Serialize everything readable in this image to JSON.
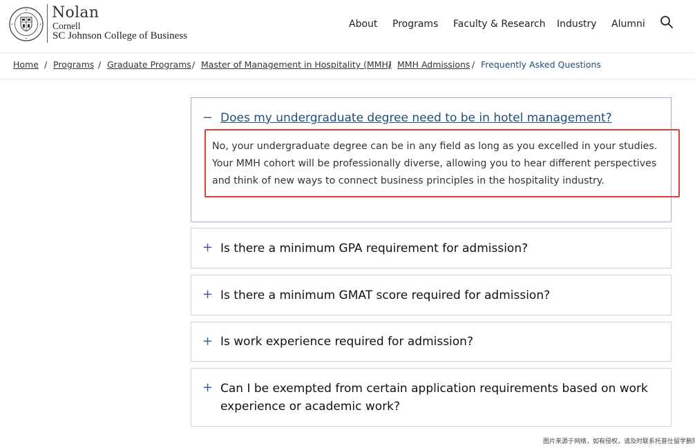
{
  "header": {
    "logo": {
      "seal_text": "CORNELL UNIVERSITY · FOUNDED A.D. 1865",
      "nolan": "Nolan",
      "cornell": "Cornell",
      "school": "SC Johnson College of Business"
    },
    "nav": [
      {
        "label": "About"
      },
      {
        "label": "Programs"
      },
      {
        "label": "Faculty & Research"
      },
      {
        "label": "Industry"
      },
      {
        "label": "Alumni"
      }
    ],
    "search_icon": "search-icon"
  },
  "breadcrumb": {
    "items": [
      "Home",
      "Programs",
      "Graduate Programs",
      "Master of Management in Hospitality (MMH)",
      "MMH Admissions"
    ],
    "separator": "/",
    "current": "Frequently Asked Questions"
  },
  "faq": {
    "items": [
      {
        "toggle": "−",
        "question": "Does my undergraduate degree need to be in hotel management?",
        "answer_lines": [
          "No, your undergraduate degree can be in any field as long as you excelled in your studies.",
          "Your MMH cohort will be professionally diverse, allowing you to hear different perspectives",
          "and think of new ways to connect business principles in the hospitality industry."
        ],
        "expanded": true
      },
      {
        "toggle": "+",
        "question": "Is there a minimum GPA requirement for admission?",
        "expanded": false
      },
      {
        "toggle": "+",
        "question": "Is there a minimum GMAT score required for admission?",
        "expanded": false
      },
      {
        "toggle": "+",
        "question": "Is work experience required for admission?",
        "expanded": false
      },
      {
        "toggle": "+",
        "question_lines": [
          "Can I be exempted from certain application requirements based on work",
          "experience or academic work?"
        ],
        "expanded": false
      }
    ]
  },
  "watermark": "图片来源于网络，如有侵权，请及时联系托普仕留学删除",
  "colors": {
    "link_blue": "#1f4e79",
    "toggle_blue": "#3a5a9a",
    "open_border": "#9db3dd",
    "panel_border": "#d4d4d4",
    "highlight_red": "#e53935"
  }
}
